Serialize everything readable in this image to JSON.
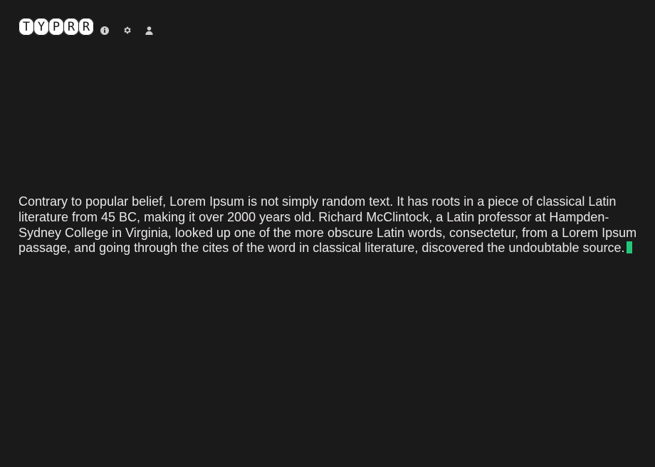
{
  "logo": {
    "letters": [
      "T",
      "Y",
      "P",
      "R",
      "R"
    ]
  },
  "nav": {
    "icons": [
      "info-icon",
      "gear-icon",
      "user-icon"
    ]
  },
  "typing": {
    "text": "Contrary to popular belief, Lorem Ipsum is not simply random text. It has roots in a piece of classical Latin literature from 45 BC, making it over 2000 years old. Richard McClintock, a Latin professor at Hampden-Sydney College in Virginia, looked up one of the more obscure Latin words, consectetur, from a Lorem Ipsum passage, and going through the cites of the word in classical literature, discovered the undoubtable source.",
    "caret_color": "#22c77a"
  },
  "colors": {
    "background": "#1b1a1a",
    "text": "#e9e7e7",
    "logo_tile": "#ffffff"
  }
}
